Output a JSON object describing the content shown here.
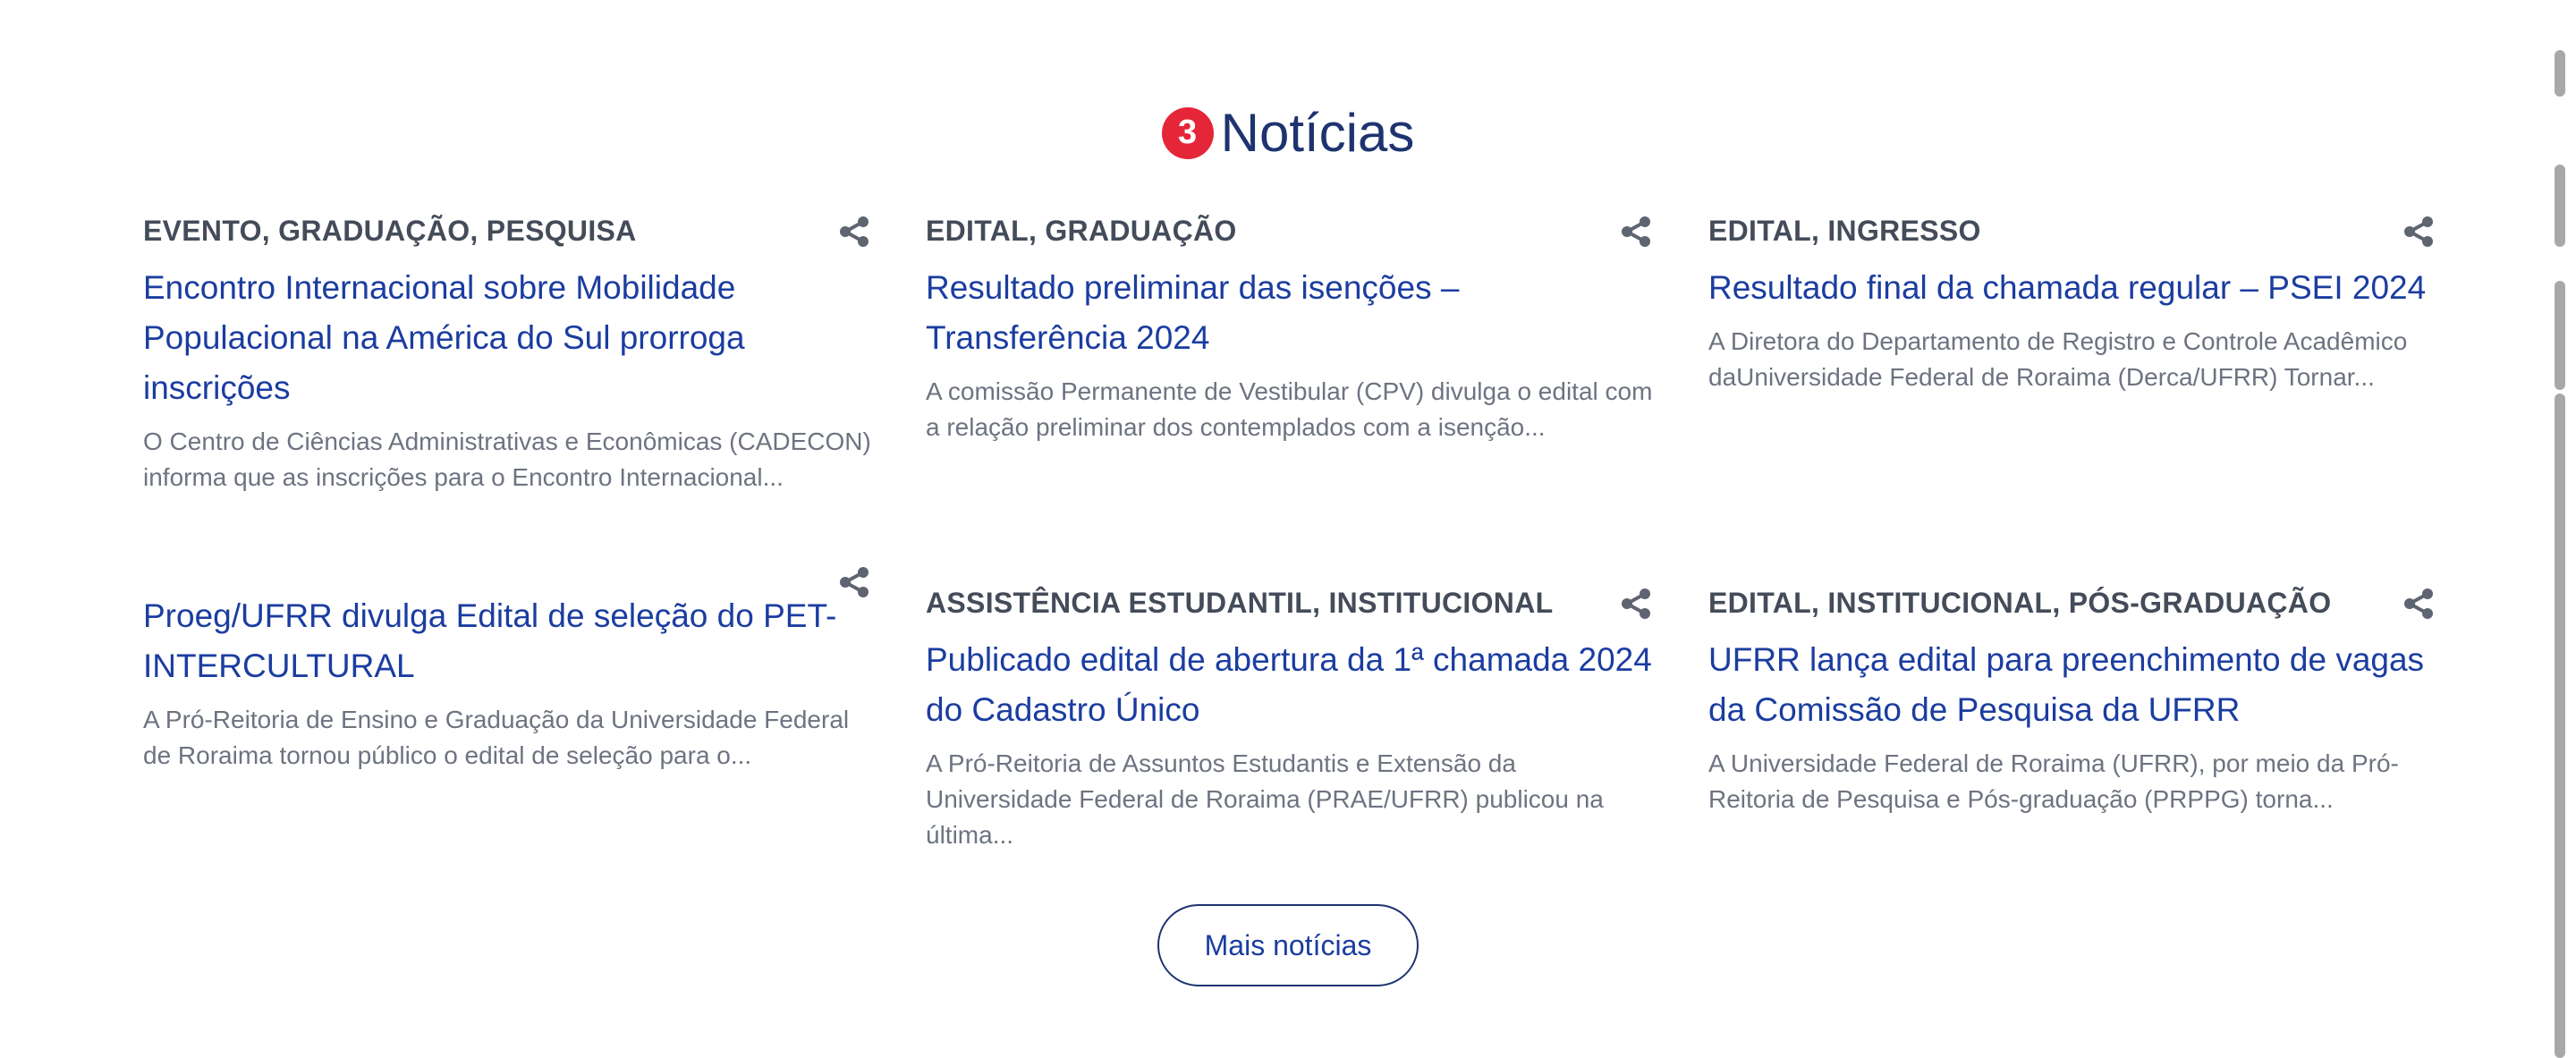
{
  "section": {
    "badge": "3",
    "title": "Notícias"
  },
  "news": [
    {
      "categories": "EVENTO, GRADUAÇÃO, PESQUISA",
      "title": "Encontro Internacional sobre Mobilidade Populacional na América do Sul prorroga inscrições",
      "excerpt": "O Centro de Ciências Administrativas e Econômicas (CADECON) informa que as inscrições para o Encontro Internacional..."
    },
    {
      "categories": "EDITAL, GRADUAÇÃO",
      "title": "Resultado preliminar das isenções – Transferência 2024",
      "excerpt": "A comissão Permanente de Vestibular (CPV) divulga o edital com a relação preliminar dos contemplados com a isenção..."
    },
    {
      "categories": "EDITAL, INGRESSO",
      "title": "Resultado final da chamada regular – PSEI 2024",
      "excerpt": "A Diretora do Departamento de Registro e Controle Acadêmico daUniversidade Federal de Roraima (Derca/UFRR) Tornar..."
    },
    {
      "categories": "",
      "title": "Proeg/UFRR divulga Edital de seleção do PET-INTERCULTURAL",
      "excerpt": "A Pró-Reitoria de Ensino e Graduação da Universidade Federal de Roraima tornou público o edital de seleção para o..."
    },
    {
      "categories": "ASSISTÊNCIA ESTUDANTIL, INSTITUCIONAL",
      "title": "Publicado edital de abertura da 1ª chamada 2024 do Cadastro Único",
      "excerpt": "A Pró-Reitoria de Assuntos Estudantis e Extensão da Universidade Federal de Roraima (PRAE/UFRR) publicou na última..."
    },
    {
      "categories": "EDITAL, INSTITUCIONAL, PÓS-GRADUAÇÃO",
      "title": "UFRR lança edital para preenchimento de vagas da Comissão de Pesquisa da UFRR",
      "excerpt": "A Universidade Federal de Roraima (UFRR), por meio da Pró-Reitoria de Pesquisa e Pós-graduação (PRPPG) torna..."
    }
  ],
  "more_button": "Mais notícias",
  "icons": {
    "share": "share-icon"
  },
  "colors": {
    "heading": "#1e3370",
    "badge": "#e52638",
    "link": "#1b3da0",
    "category": "#444c5a",
    "excerpt": "#6d7380"
  }
}
